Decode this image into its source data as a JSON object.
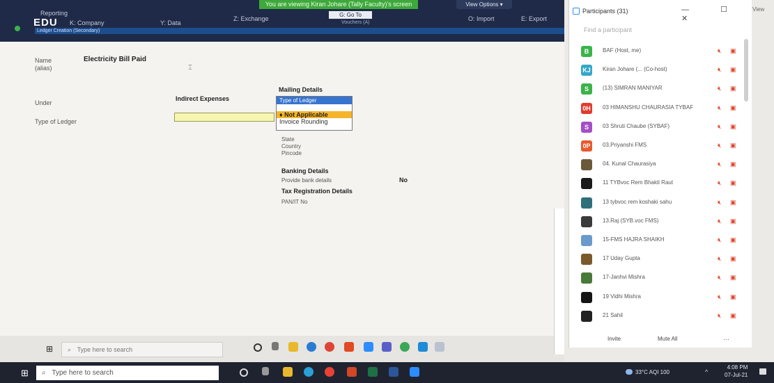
{
  "share": {
    "banner": "You are viewing Kiran Johare (Tally Faculty)'s screen",
    "view_options": "View Options ▾",
    "report_label": "Reporting"
  },
  "tally": {
    "product": "EDU",
    "menu": [
      "K: Company",
      "Y: Data",
      "Z: Exchange",
      "O: Import",
      "E: Export"
    ],
    "goto": "G: Go To",
    "vouchers": "Vouchers (A)",
    "screen_title": "Ledger Creation (Secondary)",
    "name_label": "Name",
    "name_value": "Electricity Bill Paid",
    "alias_label": "(alias)",
    "under_label": "Under",
    "under_value": "Indirect Expenses",
    "type_label": "Type of Ledger",
    "mailing_heading": "Mailing Details",
    "dropdown_title": "Type of Ledger",
    "dropdown_selected": "♦ Not Applicable",
    "dropdown_option": "Invoice Rounding",
    "state_label": "State",
    "country_label": "Country",
    "pincode_label": "Pincode",
    "banking_heading": "Banking Details",
    "bank_label": "Provide bank details",
    "bank_value": "No",
    "tax_heading": "Tax Registration Details",
    "pan_label": "PAN/IT No"
  },
  "inner_taskbar": {
    "search_placeholder": "Type here to search"
  },
  "panel": {
    "title": "Participants (31)",
    "controls": "—  ☐  ✕",
    "find_placeholder": "Find a participant",
    "participants": [
      {
        "initials": "B",
        "name": "BAF (Host, me)",
        "color": "#3bb34a"
      },
      {
        "initials": "KJ",
        "name": "Kiran Johare (... (Co-host)",
        "color": "#35a7c8"
      },
      {
        "initials": "S",
        "name": "(13) SIMRAN MANIYAR",
        "color": "#3bb34a"
      },
      {
        "initials": "0H",
        "name": "03 HIMANSHU CHAURASIA TYBAF",
        "color": "#e23a2f"
      },
      {
        "initials": "S",
        "name": "03 Shruti Chaube (SYBAF)",
        "color": "#a54fc7"
      },
      {
        "initials": "0P",
        "name": "03.Priyanshi FMS",
        "color": "#e8582c"
      },
      {
        "initials": "",
        "name": "04. Kunal Chaurasiya",
        "color": "#6b5a3a"
      },
      {
        "initials": "",
        "name": "11 TYBvoc Rem Bhakti Raut",
        "color": "#1a1a1a"
      },
      {
        "initials": "",
        "name": "13 tybvoc rem koshaki sahu",
        "color": "#2f6f7a"
      },
      {
        "initials": "",
        "name": "13.Raj (SYB.voc FMS)",
        "color": "#3a3a3a"
      },
      {
        "initials": "",
        "name": "15-FMS HAJRA SHAIKH",
        "color": "#6a9acb"
      },
      {
        "initials": "",
        "name": "17 Uday Gupta",
        "color": "#7a5a2a"
      },
      {
        "initials": "",
        "name": "17-Janhvi Mishra",
        "color": "#4a7a3a"
      },
      {
        "initials": "",
        "name": "19 Vidhi Mishra",
        "color": "#141414"
      },
      {
        "initials": "",
        "name": "21 Sahil",
        "color": "#222222"
      }
    ],
    "invite": "Invite",
    "mute_all": "Mute All",
    "more": "…",
    "view_edge": "View"
  },
  "outer_taskbar": {
    "search_placeholder": "Type here to search",
    "weather": "33°C  AQI 100",
    "time": "4:08 PM",
    "date": "07-Jul-21"
  }
}
